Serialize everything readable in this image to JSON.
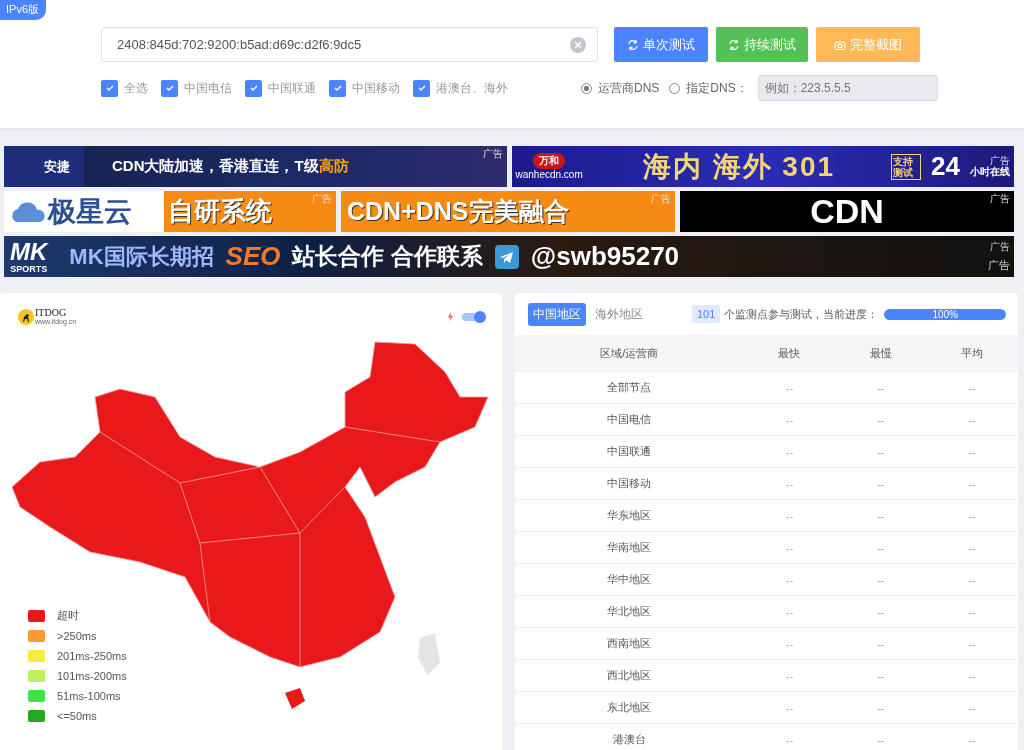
{
  "version_badge": "IPv6版",
  "query": {
    "value": "2408:845d:702:9200:b5ad:d69c:d2f6:9dc5"
  },
  "buttons": [
    {
      "label": "单次测试",
      "kind": "single"
    },
    {
      "label": "持续测试",
      "kind": "continuous"
    },
    {
      "label": "完整截图",
      "kind": "screenshot"
    }
  ],
  "carriers": [
    {
      "label": "全选",
      "checked": true
    },
    {
      "label": "中国电信",
      "checked": true
    },
    {
      "label": "中国联通",
      "checked": true
    },
    {
      "label": "中国移动",
      "checked": true
    },
    {
      "label": "港澳台、海外",
      "checked": true
    }
  ],
  "dns": {
    "options": [
      {
        "label": "运营商DNS",
        "selected": true
      },
      {
        "label": "指定DNS：",
        "selected": false
      }
    ],
    "placeholder": "例如：223.5.5.5"
  },
  "ads": [
    {
      "kind": "anjie",
      "brand": "安捷",
      "text": "CDN大陆加速，香港直连，T级",
      "highlight": "高防",
      "tags": [
        "广告"
      ]
    },
    {
      "kind": "wanhe",
      "brand": "万和",
      "site": "wanhecdn.com",
      "text": "海内 海外 301",
      "badge": "支持测试",
      "hours": "24",
      "hours_note": "小时在线",
      "tags": [
        "广告"
      ]
    },
    {
      "kind": "jixing",
      "brand": "极星云",
      "text": "自研系统",
      "tags": [
        "广告"
      ]
    },
    {
      "kind": "fusion",
      "text": "CDN+DNS完美融合",
      "tags": [
        "广告"
      ]
    },
    {
      "kind": "cdn",
      "text": "CDN",
      "tags": [
        "广告"
      ]
    },
    {
      "kind": "mk",
      "brand": "MK",
      "brand_sub": "SPORTS",
      "text": "MK国际长期招",
      "highlight": "SEO",
      "text2": "站长合作 合作联系",
      "contact": "@swb95270",
      "tags": [
        "广告",
        "广告"
      ]
    }
  ],
  "map": {
    "logo": "ITDOG",
    "logo_sub": "www.itdog.cn",
    "toggle_on": true,
    "legend": [
      {
        "label": "超时",
        "color": "#e8191b"
      },
      {
        "label": ">250ms",
        "color": "#f79b35"
      },
      {
        "label": "201ms-250ms",
        "color": "#f5ea46"
      },
      {
        "label": "101ms-200ms",
        "color": "#bff05f"
      },
      {
        "label": "51ms-100ms",
        "color": "#43e048"
      },
      {
        "label": "<=50ms",
        "color": "#22a823"
      }
    ]
  },
  "results": {
    "tabs": [
      {
        "label": "中国地区",
        "selected": true
      },
      {
        "label": "海外地区",
        "selected": false
      }
    ],
    "count": "101",
    "count_text": "个监测点参与测试，当前进度：",
    "progress": {
      "level": 1,
      "label": "100%"
    },
    "columns": [
      "区域/运营商",
      "最快",
      "最慢",
      "平均"
    ],
    "rows": [
      [
        "全部节点",
        "--",
        "--",
        "--"
      ],
      [
        "中国电信",
        "--",
        "--",
        "--"
      ],
      [
        "中国联通",
        "--",
        "--",
        "--"
      ],
      [
        "中国移动",
        "--",
        "--",
        "--"
      ],
      [
        "华东地区",
        "--",
        "--",
        "--"
      ],
      [
        "华南地区",
        "--",
        "--",
        "--"
      ],
      [
        "华中地区",
        "--",
        "--",
        "--"
      ],
      [
        "华北地区",
        "--",
        "--",
        "--"
      ],
      [
        "西南地区",
        "--",
        "--",
        "--"
      ],
      [
        "西北地区",
        "--",
        "--",
        "--"
      ],
      [
        "东北地区",
        "--",
        "--",
        "--"
      ],
      [
        "港澳台",
        "--",
        "--",
        "--"
      ]
    ]
  }
}
